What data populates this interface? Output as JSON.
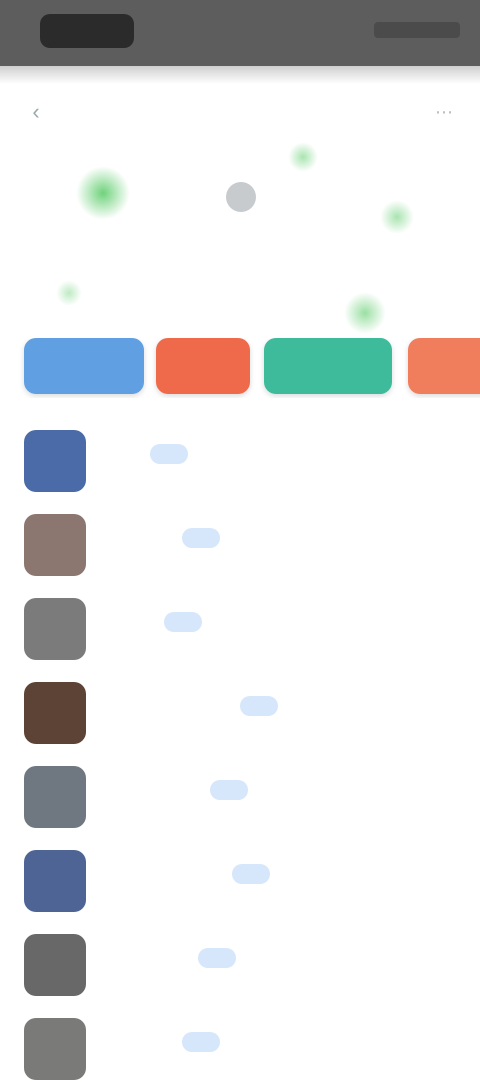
{
  "status_bar": {
    "left": "",
    "right": ""
  },
  "header": {
    "title": "",
    "back_icon": "back-arrow-icon",
    "more_icon": "more-icon"
  },
  "hero": {
    "title": "",
    "subtitle": ""
  },
  "actions": [
    {
      "label": "",
      "color": "#5f9fe2"
    },
    {
      "label": "",
      "color": "#ee6a4a"
    },
    {
      "label": "",
      "color": "#3dbb9a"
    },
    {
      "label": "",
      "color": "#f07d5c"
    }
  ],
  "list": [
    {
      "name": "",
      "tag": "",
      "thumb_color": "#4a6aa8"
    },
    {
      "name": "",
      "tag": "",
      "thumb_color": "#8c7670"
    },
    {
      "name": "",
      "tag": "",
      "thumb_color": "#7b7b7b"
    },
    {
      "name": "",
      "tag": "",
      "thumb_color": "#5c4336"
    },
    {
      "name": "",
      "tag": "",
      "thumb_color": "#6f7780"
    },
    {
      "name": "",
      "tag": "",
      "thumb_color": "#4d6495"
    },
    {
      "name": "",
      "tag": "",
      "thumb_color": "#686868"
    },
    {
      "name": "",
      "tag": "",
      "thumb_color": "#7a7a78"
    }
  ]
}
